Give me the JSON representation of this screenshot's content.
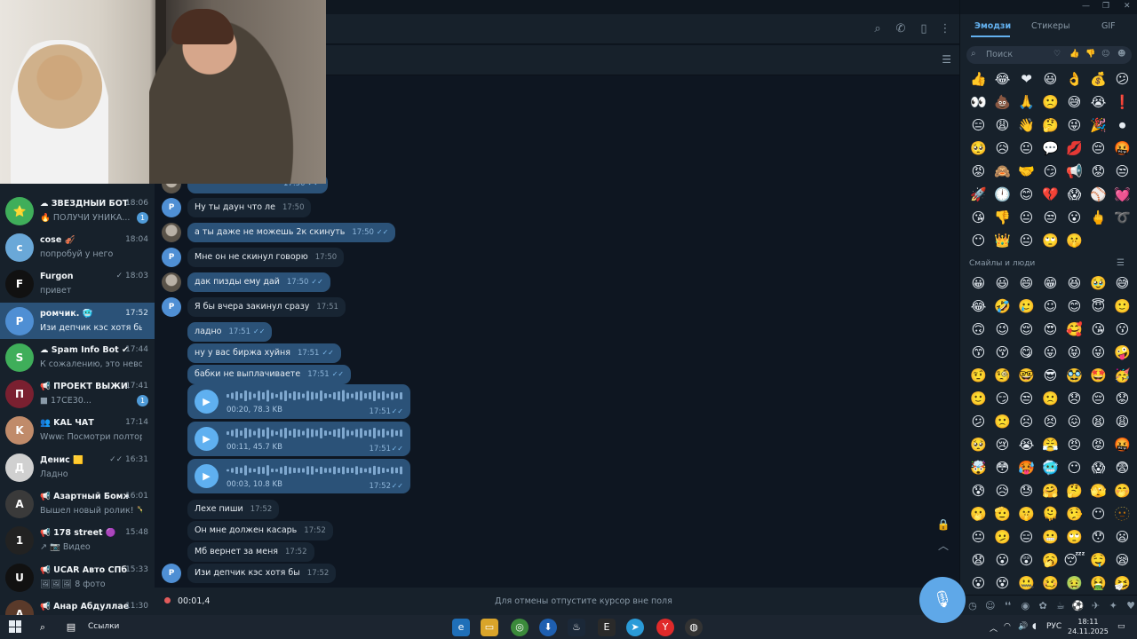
{
  "chats": [
    {
      "name": "☁ ЗВЁЗДНЫЙ БОТ",
      "time": "18:06",
      "msg": "🔥 ПОЛУЧИ УНИКА...",
      "badge": "1",
      "avatar": "⭐",
      "color": "#3fae5a"
    },
    {
      "name": "cose 🎻",
      "time": "18:04",
      "msg": "попробуй у него",
      "badge": "",
      "avatar": "c",
      "color": "#6aa8d8"
    },
    {
      "name": "Furgon",
      "time": "✓ 18:03",
      "msg": "привет",
      "badge": "",
      "avatar": "F",
      "color": "#111111"
    },
    {
      "name": "ромчик. 🥶",
      "time": "17:52",
      "msg": "Изи депчик кэс хотя бы",
      "badge": "",
      "avatar": "Р",
      "color": "#4f8fd4"
    },
    {
      "name": "☁ Spam Info Bot ✔",
      "time": "17:44",
      "msg": "К сожалению, это невозмо...",
      "badge": "",
      "avatar": "S",
      "color": "#3fae5a"
    },
    {
      "name": "📢 ПРОЕКТ ВЫЖИВ...",
      "time": "17:41",
      "msg": "■ 17CE30...",
      "badge": "1",
      "avatar": "П",
      "color": "#7a2030"
    },
    {
      "name": "👥 KAL ЧАТ",
      "time": "17:14",
      "msg": "Www: Посмотри полтора ш...",
      "badge": "",
      "avatar": "K",
      "color": "#c08b6a"
    },
    {
      "name": "Денис 🟨",
      "time": "✓✓ 16:31",
      "msg": "Ладно",
      "badge": "",
      "avatar": "Д",
      "color": "#d0d0d0"
    },
    {
      "name": "📢 Азартный Бомж",
      "time": "16:01",
      "msg": "Вышел новый ролик! 🍾 И...",
      "badge": "",
      "avatar": "А",
      "color": "#3a3a3a"
    },
    {
      "name": "📢 178 street 🟣",
      "time": "15:48",
      "msg": "↗ 📷 Видео",
      "badge": "",
      "avatar": "1",
      "color": "#222222"
    },
    {
      "name": "📢 UCAR Авто СПб",
      "time": "15:33",
      "msg": "🖼🖼🖼 8 фото",
      "badge": "",
      "avatar": "U",
      "color": "#111111"
    },
    {
      "name": "📢 Анар Абдуллаев ...",
      "time": "11:30",
      "msg": "",
      "badge": "",
      "avatar": "А",
      "color": "#5a3a2a"
    }
  ],
  "messages": [
    {
      "dir": "in",
      "who": "p",
      "text": "Ну ты даун что ле",
      "time": "17:50",
      "ck": ""
    },
    {
      "dir": "out",
      "who": "g",
      "text": "а ты даже не можешь 2к скинуть",
      "time": "17:50",
      "ck": "✓✓"
    },
    {
      "dir": "in",
      "who": "p",
      "text": "Мне он не скинул говорю",
      "time": "17:50",
      "ck": ""
    },
    {
      "dir": "out",
      "who": "g",
      "text": "дак пизды ему дай",
      "time": "17:50",
      "ck": "✓✓"
    },
    {
      "dir": "in",
      "who": "p",
      "text": "Я бы вчера закинул сразу",
      "time": "17:51",
      "ck": ""
    },
    {
      "dir": "out",
      "who": "",
      "text": "ладно",
      "time": "17:51",
      "ck": "✓✓"
    },
    {
      "dir": "out",
      "who": "",
      "text": "ну у вас биржа хуйня",
      "time": "17:51",
      "ck": "✓✓"
    },
    {
      "dir": "out",
      "who": "",
      "text": "бабки не выплачиваете",
      "time": "17:51",
      "ck": "✓✓"
    },
    {
      "dir": "in",
      "who": "",
      "text": "Лехе пиши",
      "time": "17:52",
      "ck": ""
    },
    {
      "dir": "in",
      "who": "",
      "text": "Он мне должен касарь",
      "time": "17:52",
      "ck": ""
    },
    {
      "dir": "in",
      "who": "",
      "text": "Мб вернет за меня",
      "time": "17:52",
      "ck": ""
    },
    {
      "dir": "in",
      "who": "p",
      "text": "Изи депчик кэс хотя бы",
      "time": "17:52",
      "ck": ""
    }
  ],
  "voices": [
    {
      "dur": "00:20, 78.3 KB",
      "time": "17:51",
      "ck": "✓✓"
    },
    {
      "dur": "00:11, 45.7 KB",
      "time": "17:51",
      "ck": "✓✓"
    },
    {
      "dur": "00:03, 10.8 KB",
      "time": "17:52",
      "ck": "✓✓"
    }
  ],
  "partial_message": {
    "time": "17:50",
    "ck": "✓✓"
  },
  "avatar_letter": "Р",
  "input": {
    "timer": "00:01,4",
    "hint": "Для отмены отпустите курсор вне поля"
  },
  "emoji_panel": {
    "tabs": [
      "Эмодзи",
      "Стикеры",
      "GIF"
    ],
    "search_placeholder": "Поиск",
    "section": "Смайлы и люди",
    "recent": [
      "👍",
      "😂",
      "❤",
      "😃",
      "👌",
      "💰",
      "😕",
      "👀",
      "💩",
      "🙏",
      "🙁",
      "😅",
      "😭",
      "❗",
      "😑",
      "😩",
      "👋",
      "🤔",
      "😜",
      "🎉",
      "⏺",
      "🥺",
      "😥",
      "😐",
      "💬",
      "💋",
      "😔",
      "🤬",
      "😡",
      "🙈",
      "🤝",
      "😏",
      "📢",
      "😟",
      "😒",
      "🚀",
      "🕛",
      "😊",
      "💔",
      "😱",
      "⚾",
      "💓",
      "😘",
      "👎",
      "😐",
      "😒",
      "😮",
      "🖕",
      "➰",
      "😶",
      "👑",
      "😐",
      "🙄",
      "🤫"
    ],
    "smileys": [
      "😀",
      "😃",
      "😄",
      "😁",
      "😆",
      "🥹",
      "😅",
      "😂",
      "🤣",
      "🥲",
      "☺",
      "😊",
      "😇",
      "🙂",
      "🙃",
      "😉",
      "😌",
      "😍",
      "🥰",
      "😘",
      "😗",
      "😙",
      "😚",
      "😋",
      "😛",
      "😝",
      "😜",
      "🤪",
      "🤨",
      "🧐",
      "🤓",
      "😎",
      "🥸",
      "🤩",
      "🥳",
      "🙂",
      "😏",
      "😒",
      "🙁",
      "😞",
      "😔",
      "😟",
      "😕",
      "🙁",
      "☹",
      "😣",
      "😖",
      "😫",
      "😩",
      "🥺",
      "😢",
      "😭",
      "😤",
      "😠",
      "😡",
      "🤬",
      "🤯",
      "😳",
      "🥵",
      "🥶",
      "😶",
      "😱",
      "😨",
      "😰",
      "😥",
      "😓",
      "🤗",
      "🤔",
      "🫣",
      "🤭",
      "🫢",
      "🫡",
      "🤫",
      "🫠",
      "🤥",
      "😶",
      "🫥",
      "😐",
      "🫤",
      "😑",
      "😬",
      "🙄",
      "😯",
      "😦",
      "😧",
      "😮",
      "😲",
      "🥱",
      "😴",
      "🤤",
      "😪",
      "😮",
      "😵",
      "🤐",
      "🥴",
      "🤢",
      "🤮",
      "🤧",
      "😷"
    ]
  },
  "taskbar": {
    "search_label": "Ссылки",
    "lang": "РУС",
    "time": "18:11",
    "date": "24.11.2025"
  }
}
